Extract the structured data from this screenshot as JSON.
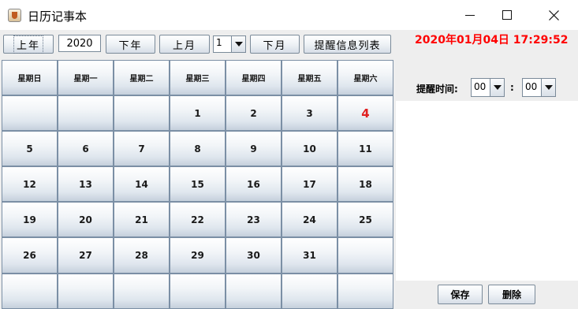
{
  "window": {
    "title": "日历记事本",
    "minimize_icon": "minimize-icon",
    "maximize_icon": "maximize-icon",
    "close_icon": "close-icon"
  },
  "toolbar": {
    "prev_year_label": "上年",
    "year_value": "2020",
    "next_year_label": "下年",
    "prev_month_label": "上月",
    "month_value": "1",
    "next_month_label": "下月",
    "reminder_list_label": "提醒信息列表"
  },
  "calendar": {
    "weekdays": [
      "星期日",
      "星期一",
      "星期二",
      "星期三",
      "星期四",
      "星期五",
      "星期六"
    ],
    "days": [
      "",
      "",
      "",
      "1",
      "2",
      "3",
      "4",
      "5",
      "6",
      "7",
      "8",
      "9",
      "10",
      "11",
      "12",
      "13",
      "14",
      "15",
      "16",
      "17",
      "18",
      "19",
      "20",
      "21",
      "22",
      "23",
      "24",
      "25",
      "26",
      "27",
      "28",
      "29",
      "30",
      "31",
      "",
      "",
      "",
      "",
      "",
      "",
      "",
      ""
    ],
    "today": "4",
    "today_color": "#e02020"
  },
  "side": {
    "datetime": "2020年01月04日 17:29:52",
    "datetime_color": "#ff0000",
    "remind_label": "提醒时间:",
    "hour_value": "00",
    "colon": ":",
    "minute_value": "00",
    "save_label": "保存",
    "delete_label": "删除"
  }
}
